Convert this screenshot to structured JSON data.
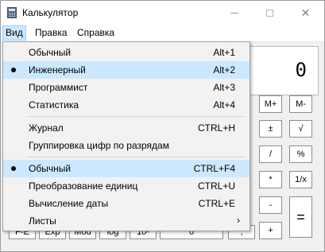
{
  "window": {
    "title": "Калькулятор",
    "controls": {
      "minimize": "",
      "maximize": "",
      "close": "✕"
    }
  },
  "menubar": {
    "items": [
      {
        "label": "Вид"
      },
      {
        "label": "Правка"
      },
      {
        "label": "Справка"
      }
    ]
  },
  "display": {
    "value": "0"
  },
  "keys": {
    "right_col1": [
      "M+",
      "±",
      "/",
      "*",
      "-",
      "+"
    ],
    "right_col2": [
      "M-",
      "√",
      "%",
      "1/x",
      "="
    ],
    "bottom_row": [
      "F-E",
      "Exp",
      "Mod",
      "log",
      "10ˣ",
      "0",
      ","
    ]
  },
  "view_menu": {
    "items": [
      {
        "label": "Обычный",
        "shortcut": "Alt+1",
        "bullet": false,
        "highlight": false
      },
      {
        "label": "Инженерный",
        "shortcut": "Alt+2",
        "bullet": true,
        "highlight": true
      },
      {
        "label": "Программист",
        "shortcut": "Alt+3",
        "bullet": false,
        "highlight": false
      },
      {
        "label": "Статистика",
        "shortcut": "Alt+4",
        "bullet": false,
        "highlight": false
      },
      {
        "label": "Журнал",
        "shortcut": "CTRL+H",
        "bullet": false,
        "highlight": false
      },
      {
        "label": "Группировка цифр по разрядам",
        "shortcut": "",
        "bullet": false,
        "highlight": false
      },
      {
        "label": "Обычный",
        "shortcut": "CTRL+F4",
        "bullet": true,
        "highlight": true
      },
      {
        "label": "Преобразование единиц",
        "shortcut": "CTRL+U",
        "bullet": false,
        "highlight": false
      },
      {
        "label": "Вычисление даты",
        "shortcut": "CTRL+E",
        "bullet": false,
        "highlight": false
      },
      {
        "label": "Листы",
        "shortcut": "",
        "bullet": false,
        "highlight": false,
        "submenu_arrow": "›"
      }
    ]
  }
}
